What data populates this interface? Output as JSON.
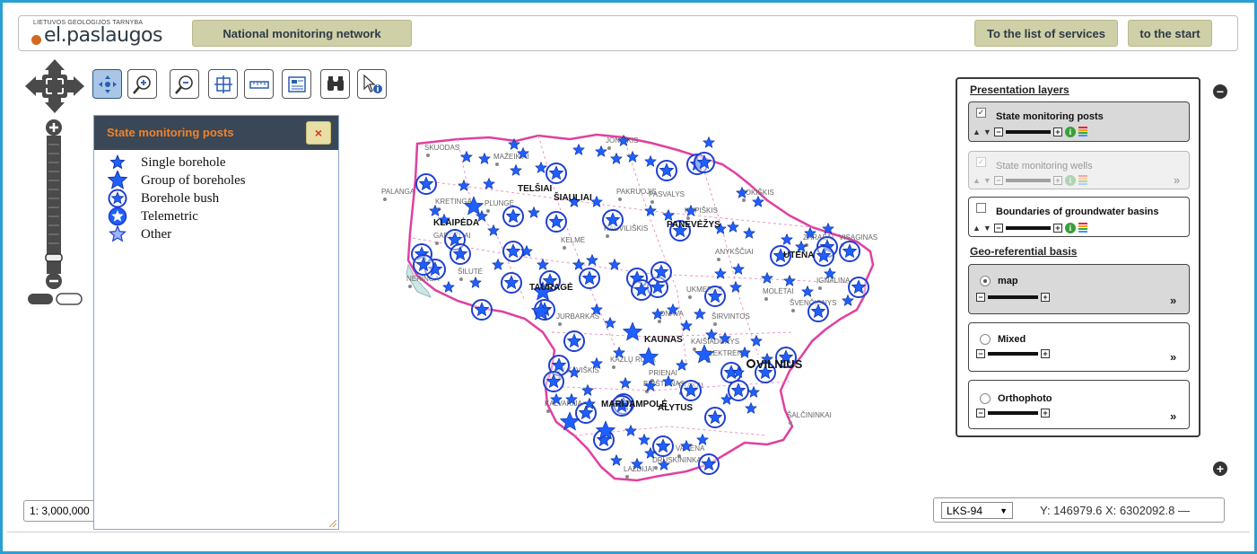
{
  "header": {
    "logo_small": "LIETUVOS GEOLOGIJOS TARNYBA",
    "logo_text": "el.paslaugos",
    "network_label": "National monitoring network",
    "services_label": "To the list of services",
    "start_label": "to the start"
  },
  "toolbar": {
    "tools": [
      {
        "icon": "pan-icon",
        "active": true
      },
      {
        "icon": "zoom-in-icon",
        "active": false
      },
      {
        "icon": "zoom-out-icon",
        "active": false
      },
      {
        "icon": "full-extent-icon",
        "active": false
      },
      {
        "icon": "measure-icon",
        "active": false
      },
      {
        "icon": "layout-icon",
        "active": false
      },
      {
        "icon": "binoculars-icon",
        "active": false
      },
      {
        "icon": "identify-icon",
        "active": false
      }
    ]
  },
  "scale": {
    "value": "1: 3,000,000"
  },
  "legend": {
    "title": "State monitoring posts",
    "close_label": "×",
    "items": [
      {
        "label": "Single borehole",
        "symbol": "small-star"
      },
      {
        "label": "Group of boreholes",
        "symbol": "large-star"
      },
      {
        "label": "Borehole bush",
        "symbol": "ring-star"
      },
      {
        "label": "Telemetric",
        "symbol": "filled-ring-star"
      },
      {
        "label": "Other",
        "symbol": "outline-star"
      }
    ]
  },
  "map": {
    "cities_bold": [
      "TELŠIAI",
      "ŠIAULIAI",
      "KLAIPĖDA",
      "PANEVĖŽYS",
      "UTENA",
      "TAURAGĖ",
      "KAUNAS",
      "MARIJAMPOLĖ",
      "ALYTUS",
      "VILNIUS"
    ],
    "towns": [
      "SKUODAS",
      "MAŽEIKIAI",
      "JONIŠKIS",
      "PALANGA",
      "KRETINGA",
      "PLUNGĖ",
      "PAKRUOJIS",
      "PASVALYS",
      "KUPIŠKIS",
      "ROKIŠKIS",
      "ZARASAI",
      "VISAGINAS",
      "GARGŽDAI",
      "KELMĖ",
      "RADVILIŠKIS",
      "ANYKŠČIAI",
      "IGNALINA",
      "ŠILUTĖ",
      "NERINGA",
      "UKMERGĖ",
      "MOLĖTAI",
      "ŠVENČIONYS",
      "JURBARKAS",
      "JONAVA",
      "ŠIRVINTOS",
      "KAIŠIADORYS",
      "ELEKTRĖNAI",
      "VILKAVIŠKIS",
      "KAZLŲ RŪDA",
      "PRIENAI",
      "BIRŠTONAS",
      "TRAKAI",
      "KALVARIJA",
      "ŠALČININKAI",
      "VARĖNA",
      "DRUSKININKAI",
      "LAZDIJAI"
    ]
  },
  "panel": {
    "presentation_header": "Presentation layers",
    "layers": [
      {
        "name": "State monitoring posts",
        "checked": true,
        "enabled": true
      },
      {
        "name": "State monitoring wells",
        "checked": true,
        "enabled": false
      },
      {
        "name": "Boundaries of groundwater basins",
        "checked": false,
        "enabled": true
      }
    ],
    "geo_header": "Geo-referential basis",
    "bases": [
      {
        "name": "map",
        "selected": true
      },
      {
        "name": "Mixed",
        "selected": false
      },
      {
        "name": "Orthophoto",
        "selected": false
      }
    ]
  },
  "coordinates": {
    "projection": "LKS-94",
    "text": "Y: 146979.6 X: 6302092.8 —"
  },
  "colors": {
    "frame": "#2a9fd0",
    "accent_button": "#cfcfa8",
    "legend_header": "#3a4756",
    "legend_title": "#f0832c",
    "marker": "#1f5fff",
    "border_pink": "#e0409f"
  }
}
